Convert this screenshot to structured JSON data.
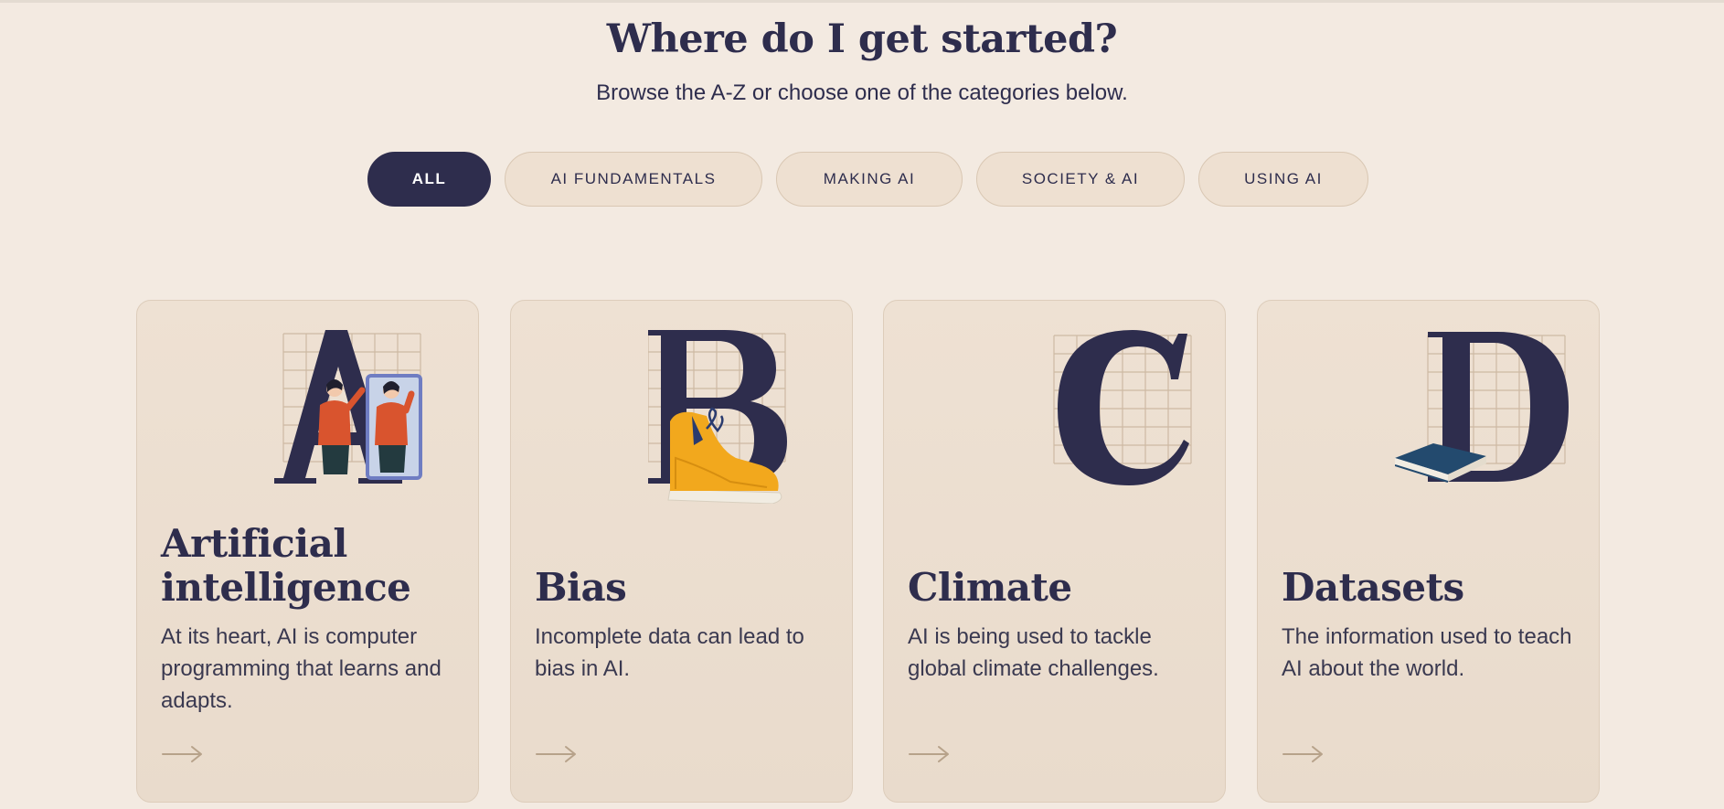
{
  "page": {
    "title": "Where do I get started?",
    "subtitle": "Browse the A-Z or choose one of the categories below."
  },
  "filters": [
    {
      "label": "ALL",
      "active": true
    },
    {
      "label": "AI FUNDAMENTALS",
      "active": false
    },
    {
      "label": "MAKING AI",
      "active": false
    },
    {
      "label": "SOCIETY & AI",
      "active": false
    },
    {
      "label": "USING AI",
      "active": false
    }
  ],
  "cards": [
    {
      "letter": "A",
      "title_line1": "Artificial",
      "title_line2": "intelligence",
      "description": "At its heart, AI is computer programming that learns and adapts.",
      "illustration": "people-mirror-illustration"
    },
    {
      "letter": "B",
      "title": "Bias",
      "description": "Incomplete data can lead to bias in AI.",
      "illustration": "sneaker-illustration"
    },
    {
      "letter": "C",
      "title": "Climate",
      "description": "AI is being used to tackle global climate challenges.",
      "illustration": "letter-illustration"
    },
    {
      "letter": "D",
      "title": "Datasets",
      "description": "The information used to teach AI about the world.",
      "illustration": "book-illustration"
    }
  ],
  "colors": {
    "background": "#f3eae1",
    "card": "#ebddce",
    "accent": "#2e2d4d",
    "grid": "#cdb9a3",
    "sweater": "#d9542e",
    "shoe": "#f2a81d",
    "book": "#234a6e",
    "arrow": "#b7a28a"
  },
  "icons": {
    "arrow": "arrow-right-icon"
  }
}
